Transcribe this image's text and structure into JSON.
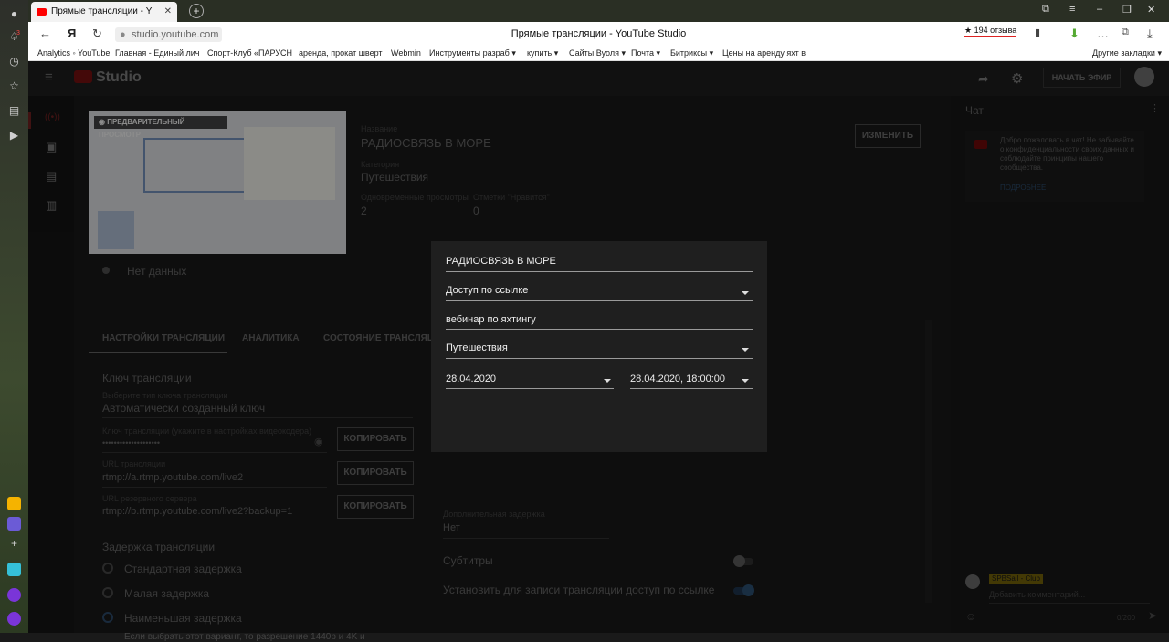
{
  "browser": {
    "tab_title": "Прямые трансляции - Y",
    "url": "studio.youtube.com",
    "page_title": "Прямые трансляции - YouTube Studio",
    "rating": "★ 194 отзыва",
    "notification_count": "3",
    "bookmarks": [
      "Analytics ◦ YouTube",
      "Главная - Единый лич",
      "Спорт-Клуб «ПАРУСН",
      "аренда, прокат шверт",
      "Webmin",
      "Инструменты разраб ▾",
      "купить ▾",
      "Сайты Вуоля ▾",
      "Почта ▾",
      "Битриксы ▾",
      "Цены на аренду яхт в"
    ],
    "other_bookmarks": "Другие закладки ▾"
  },
  "studio": {
    "logo": "Studio",
    "start_button": "НАЧАТЬ ЭФИР",
    "preview_label": "ПРЕДВАРИТЕЛЬНЫЙ ПРОСМОТР",
    "stream_title_label": "Название",
    "stream_title": "РАДИОСВЯЗЬ В МОРЕ",
    "category_label": "Категория",
    "category": "Путешествия",
    "viewers_label": "Одновременные просмотры",
    "viewers": "2",
    "likes_label": "Отметки \"Нравится\"",
    "likes": "0",
    "edit_button": "ИЗМЕНИТЬ",
    "status": "Нет данных",
    "tabs": [
      "НАСТРОЙКИ ТРАНСЛЯЦИИ",
      "АНАЛИТИКА",
      "СОСТОЯНИЕ ТРАНСЛЯЦИИ"
    ],
    "key_section": "Ключ трансляции",
    "key_type_label": "Выберите тип ключа трансляции",
    "key_type": "Автоматически созданный ключ",
    "key_field_label": "Ключ трансляции (укажите в настройках видеокодера)",
    "key_value": "••••••••••••••••••••",
    "copy": "КОПИРОВАТЬ",
    "url_label": "URL трансляции",
    "url_value": "rtmp://a.rtmp.youtube.com/live2",
    "backup_label": "URL резервного сервера",
    "backup_value": "rtmp://b.rtmp.youtube.com/live2?backup=1",
    "latency_section": "Задержка трансляции",
    "latency_options": [
      "Стандартная задержка",
      "Малая задержка",
      "Наименьшая задержка"
    ],
    "latency_note": "Если выбрать этот вариант, то разрешение 1440p и 4K и",
    "extra_delay_label": "Дополнительная задержка",
    "extra_delay": "Нет",
    "subtitles": "Субтитры",
    "link_access": "Установить для записи трансляции доступ по ссылке"
  },
  "chat": {
    "title": "Чат",
    "welcome": "Добро пожаловать в чат! Не забывайте о конфиденциальности своих данных и соблюдайте принципы нашего сообщества.",
    "more": "ПОДРОБНЕЕ",
    "user": "SPBSail - Club",
    "placeholder": "Добавить комментарий...",
    "counter": "0/200"
  },
  "dialog": {
    "title": "РАДИОСВЯЗЬ В МОРЕ",
    "visibility": "Доступ по ссылке",
    "description": "вебинар по яхтингу",
    "category": "Путешествия",
    "date": "28.04.2020",
    "datetime": "28.04.2020, 18:00:00"
  }
}
